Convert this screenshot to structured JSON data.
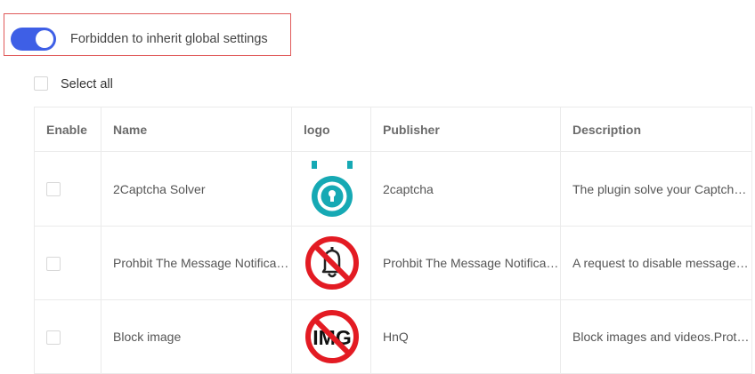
{
  "toggle": {
    "label": "Forbidden to inherit global settings",
    "enabled": true
  },
  "select_all": {
    "label": "Select all",
    "checked": false
  },
  "table": {
    "columns": [
      "Enable",
      "Name",
      "logo",
      "Publisher",
      "Description"
    ],
    "rows": [
      {
        "name": "2Captcha Solver",
        "logo": "2captcha-logo-icon",
        "publisher": "2captcha",
        "description": "The plugin solve your Captcha automatically",
        "enabled": false
      },
      {
        "name": "Prohbit The Message Notification",
        "logo": "bell-prohibited-icon",
        "publisher": "Prohbit The Message Notification",
        "description": "A request to disable message notifications",
        "enabled": false
      },
      {
        "name": "Block image",
        "logo": "img-prohibited-icon",
        "publisher": "HnQ",
        "description": "Block images and videos.Protect your privacy",
        "enabled": false
      }
    ]
  },
  "colors": {
    "switch_on": "#3e5fe6",
    "highlight_border": "#e05a5a",
    "prohibited_red": "#e31b23",
    "captcha_teal": "#16a9b4"
  }
}
